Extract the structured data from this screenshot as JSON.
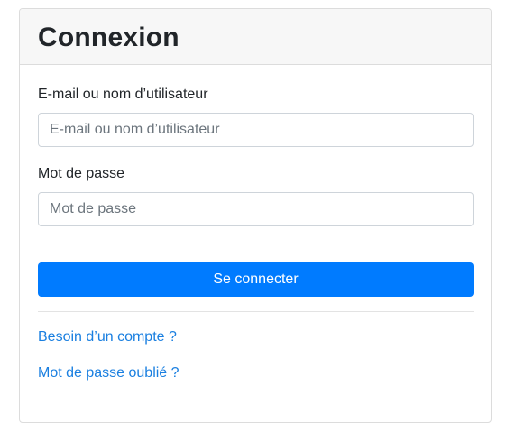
{
  "header": {
    "title": "Connexion"
  },
  "form": {
    "login": {
      "label": "E-mail ou nom d’utilisateur",
      "placeholder": "E-mail ou nom d’utilisateur",
      "value": ""
    },
    "password": {
      "label": "Mot de passe",
      "placeholder": "Mot de passe",
      "value": ""
    },
    "submit_label": "Se connecter"
  },
  "links": {
    "register": "Besoin d’un compte ?",
    "forgot_password": "Mot de passe oublié ?"
  },
  "colors": {
    "primary": "#007bff",
    "link": "#1a7fe0",
    "header_background": "#f7f7f7",
    "border": "#dcdcdc"
  }
}
